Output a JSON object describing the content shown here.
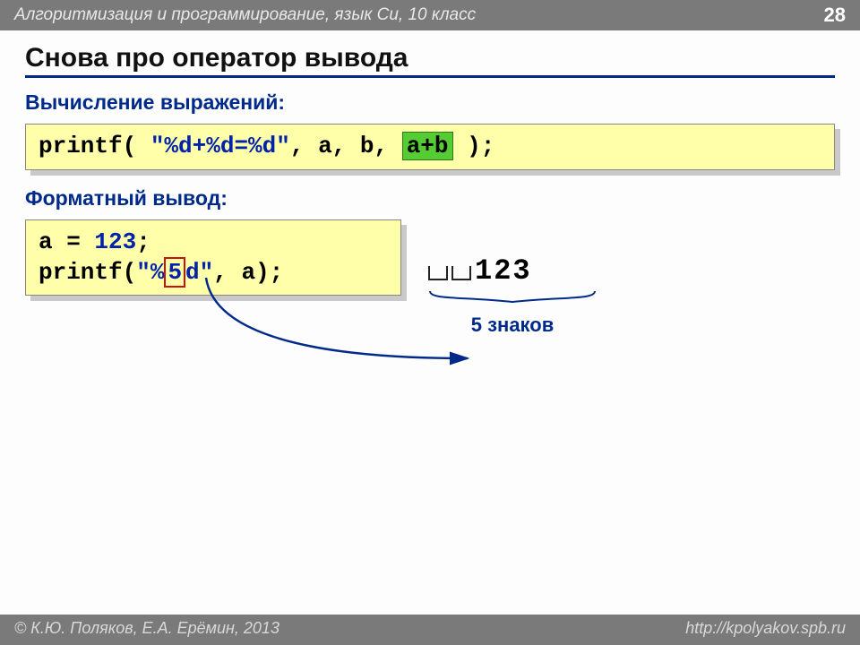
{
  "header": {
    "course": "Алгоритмизация и программирование, язык Си, 10 класс",
    "page": "28"
  },
  "title": "Снова про оператор вывода",
  "sections": {
    "expr_label": "Вычисление выражений:",
    "format_label": "Форматный вывод:"
  },
  "code1": {
    "a": "printf( ",
    "fmt": "\"%d+%d=%d\"",
    "b": ", a, b, ",
    "hl": "a+b",
    "c": " );"
  },
  "code2": {
    "l1a": "a = ",
    "l1b": "123",
    "l1c": ";",
    "l2a": "printf(",
    "l2b": "\"%",
    "l2hl": "5",
    "l2c": "d\"",
    "l2d": ", a);"
  },
  "output": {
    "value": "123",
    "annotation": "5 знаков"
  },
  "footer": {
    "authors": "© К.Ю. Поляков, Е.А. Ерёмин, 2013",
    "url": "http://kpolyakov.spb.ru"
  }
}
